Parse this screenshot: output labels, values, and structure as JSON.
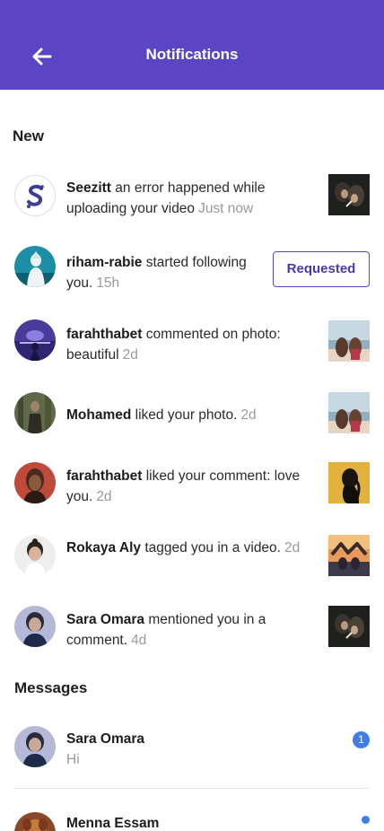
{
  "header": {
    "title": "Notifications",
    "back_icon": "arrow-left-icon",
    "color": "#5b45c4"
  },
  "sections": {
    "new": "New",
    "messages": "Messages"
  },
  "notifications": [
    {
      "user": "Seezitt",
      "text": "an error happened while uploading your video",
      "time": "Just now"
    },
    {
      "user": "riham-rabie",
      "text": "started following you.",
      "time": "15h",
      "action": "Requested"
    },
    {
      "user": "farahthabet",
      "text": "commented on photo: beautiful",
      "time": "2d"
    },
    {
      "user": "Mohamed",
      "text": "liked your photo.",
      "time": "2d"
    },
    {
      "user": "farahthabet",
      "text": "liked your comment: love you.",
      "time": "2d"
    },
    {
      "user": "Rokaya Aly",
      "text": "tagged you in a video.",
      "time": "2d"
    },
    {
      "user": "Sara Omara",
      "text": "mentioned you in a comment.",
      "time": "4d"
    }
  ],
  "messages": [
    {
      "name": "Sara Omara",
      "preview": "Hi",
      "unread": "1"
    },
    {
      "name": "Menna Essam",
      "preview": ""
    }
  ],
  "colors": {
    "accent": "#5b45c4",
    "badge": "#3f7ee8",
    "muted": "#9a9a9a"
  }
}
